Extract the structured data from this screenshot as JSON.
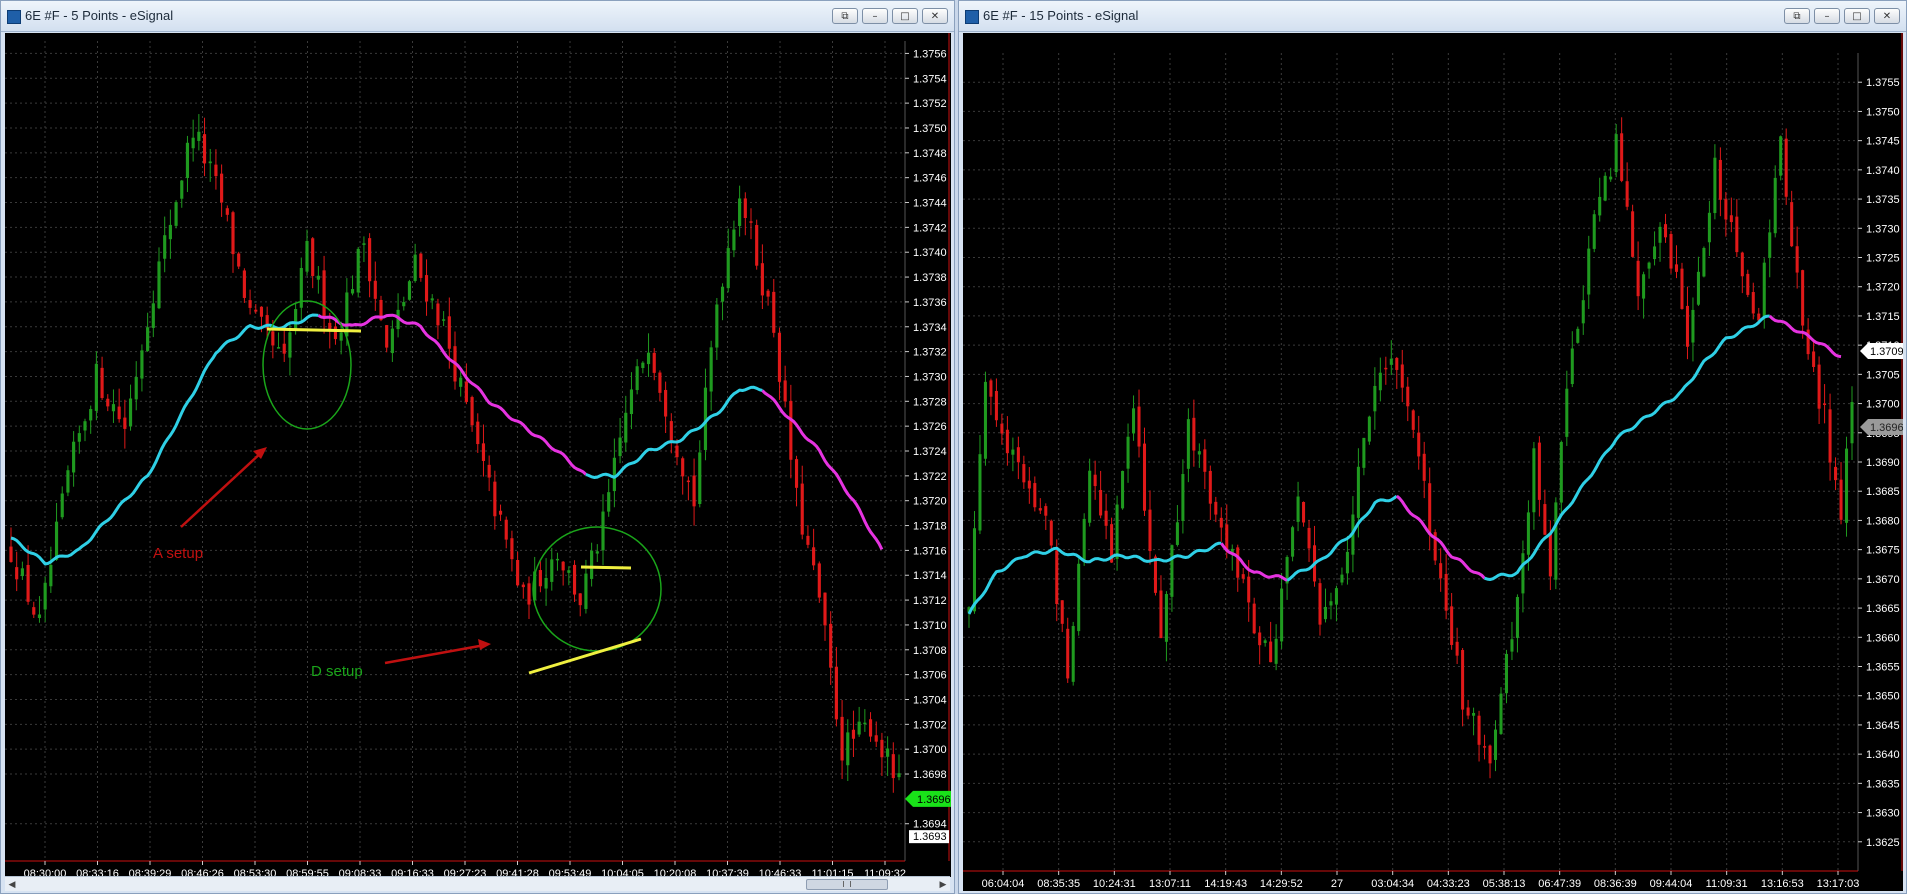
{
  "colors": {
    "bull": "#1f9a1f",
    "bear": "#e01919",
    "ma_up": "#2fd0e6",
    "ma_down": "#e633e0",
    "grid": "#3a3a3a",
    "price_tag": "#19e219",
    "annot_red": "#c01010",
    "annot_green": "#1aa51a",
    "trendline": "#f0f040"
  },
  "left": {
    "title": "6E #F - 5 Points - eSignal",
    "controls": [
      "restore-icon",
      "minimize-icon",
      "maximize-icon",
      "close-icon"
    ],
    "price_tag": "1.3696",
    "price_tag_value": 1.3696,
    "price_tag_low": "1.3693",
    "price_tag_low_value": 1.3693,
    "chart_data": {
      "type": "candlestick",
      "y_ticks": [
        "1.3756",
        "1.3754",
        "1.3752",
        "1.3750",
        "1.3748",
        "1.3746",
        "1.3744",
        "1.3742",
        "1.3740",
        "1.3738",
        "1.3736",
        "1.3734",
        "1.3732",
        "1.3730",
        "1.3728",
        "1.3726",
        "1.3724",
        "1.3722",
        "1.3720",
        "1.3718",
        "1.3716",
        "1.3714",
        "1.3712",
        "1.3710",
        "1.3708",
        "1.3706",
        "1.3704",
        "1.3702",
        "1.3700",
        "1.3698",
        "1.3694"
      ],
      "ylim": [
        1.3691,
        1.3757
      ],
      "x_ticks": [
        "08:30:00",
        "08:33:16",
        "08:39:29",
        "08:46:26",
        "08:53:30",
        "08:59:55",
        "09:08:33",
        "09:16:33",
        "09:27:23",
        "09:41:28",
        "09:53:49",
        "10:04:05",
        "10:20:08",
        "10:37:39",
        "10:46:33",
        "11:01:15",
        "11:09:32"
      ],
      "anchors": [
        [
          0,
          1.3716
        ],
        [
          5,
          1.371
        ],
        [
          10,
          1.3722
        ],
        [
          15,
          1.373
        ],
        [
          20,
          1.3726
        ],
        [
          25,
          1.3737
        ],
        [
          32,
          1.375
        ],
        [
          37,
          1.3744
        ],
        [
          42,
          1.3735
        ],
        [
          48,
          1.3731
        ],
        [
          52,
          1.374
        ],
        [
          57,
          1.3733
        ],
        [
          62,
          1.3741
        ],
        [
          66,
          1.3732
        ],
        [
          71,
          1.3739
        ],
        [
          76,
          1.3734
        ],
        [
          82,
          1.3724
        ],
        [
          86,
          1.3718
        ],
        [
          90,
          1.3712
        ],
        [
          96,
          1.3716
        ],
        [
          100,
          1.3712
        ],
        [
          104,
          1.3718
        ],
        [
          108,
          1.3727
        ],
        [
          112,
          1.3733
        ],
        [
          116,
          1.3726
        ],
        [
          120,
          1.372
        ],
        [
          124,
          1.3736
        ],
        [
          128,
          1.3745
        ],
        [
          134,
          1.3734
        ],
        [
          138,
          1.372
        ],
        [
          142,
          1.3712
        ],
        [
          146,
          1.37
        ],
        [
          151,
          1.3702
        ],
        [
          156,
          1.3697
        ]
      ],
      "ma": [
        [
          0,
          1.3717
        ],
        [
          6,
          1.3715
        ],
        [
          12,
          1.3716
        ],
        [
          18,
          1.3719
        ],
        [
          24,
          1.3722
        ],
        [
          30,
          1.3727
        ],
        [
          36,
          1.3732
        ],
        [
          42,
          1.3734
        ],
        [
          48,
          1.3734
        ],
        [
          54,
          1.3735
        ],
        [
          60,
          1.3734
        ],
        [
          66,
          1.3735
        ],
        [
          72,
          1.3734
        ],
        [
          78,
          1.3731
        ],
        [
          84,
          1.3728
        ],
        [
          90,
          1.3726
        ],
        [
          96,
          1.3724
        ],
        [
          101,
          1.3722
        ],
        [
          106,
          1.3722
        ],
        [
          112,
          1.3724
        ],
        [
          118,
          1.3725
        ],
        [
          124,
          1.3727
        ],
        [
          128,
          1.3729
        ],
        [
          132,
          1.3729
        ],
        [
          136,
          1.3727
        ],
        [
          142,
          1.3724
        ],
        [
          148,
          1.372
        ],
        [
          153,
          1.3716
        ]
      ],
      "ma_split": [
        {
          "from": 0,
          "to": 54,
          "kind": "up"
        },
        {
          "from": 54,
          "to": 101,
          "kind": "down"
        },
        {
          "from": 101,
          "to": 132,
          "kind": "up"
        },
        {
          "from": 132,
          "to": 153,
          "kind": "down"
        }
      ],
      "n_bars": 157
    },
    "annotations": {
      "a_setup": "A setup",
      "d_setup": "D setup"
    }
  },
  "right": {
    "title": "6E #F - 15 Points - eSignal",
    "controls": [
      "restore-icon",
      "minimize-icon",
      "maximize-icon",
      "close-icon"
    ],
    "price_tag": "1.3709",
    "price_tag_value": 1.3709,
    "price_tag2": "1.3696",
    "price_tag2_value": 1.3696,
    "chart_data": {
      "type": "candlestick",
      "y_ticks": [
        "1.3755",
        "1.3750",
        "1.3745",
        "1.3740",
        "1.3735",
        "1.3730",
        "1.3725",
        "1.3720",
        "1.3715",
        "1.3710",
        "1.3705",
        "1.3700",
        "1.3695",
        "1.3690",
        "1.3685",
        "1.3680",
        "1.3675",
        "1.3670",
        "1.3665",
        "1.3660",
        "1.3655",
        "1.3650",
        "1.3645",
        "1.3640",
        "1.3635",
        "1.3630",
        "1.3625"
      ],
      "ylim": [
        1.362,
        1.376
      ],
      "x_ticks": [
        "06:04:04",
        "08:35:35",
        "10:24:31",
        "13:07:11",
        "14:19:43",
        "14:29:52",
        "27",
        "03:04:34",
        "04:33:23",
        "05:38:13",
        "06:47:39",
        "08:36:39",
        "09:44:04",
        "11:09:31",
        "13:16:53",
        "13:17:03"
      ],
      "anchors": [
        [
          0,
          1.3665
        ],
        [
          3,
          1.3705
        ],
        [
          8,
          1.369
        ],
        [
          14,
          1.368
        ],
        [
          18,
          1.3655
        ],
        [
          22,
          1.369
        ],
        [
          26,
          1.3675
        ],
        [
          30,
          1.37
        ],
        [
          35,
          1.366
        ],
        [
          40,
          1.3695
        ],
        [
          46,
          1.368
        ],
        [
          51,
          1.3665
        ],
        [
          55,
          1.3655
        ],
        [
          60,
          1.3685
        ],
        [
          64,
          1.3662
        ],
        [
          69,
          1.3675
        ],
        [
          73,
          1.37
        ],
        [
          78,
          1.3708
        ],
        [
          82,
          1.369
        ],
        [
          86,
          1.3668
        ],
        [
          90,
          1.365
        ],
        [
          95,
          1.364
        ],
        [
          100,
          1.3665
        ],
        [
          103,
          1.369
        ],
        [
          106,
          1.3672
        ],
        [
          110,
          1.371
        ],
        [
          114,
          1.373
        ],
        [
          118,
          1.3745
        ],
        [
          122,
          1.372
        ],
        [
          127,
          1.373
        ],
        [
          131,
          1.3712
        ],
        [
          136,
          1.374
        ],
        [
          140,
          1.3725
        ],
        [
          144,
          1.3715
        ],
        [
          148,
          1.3745
        ],
        [
          152,
          1.3712
        ],
        [
          156,
          1.3698
        ],
        [
          159,
          1.368
        ],
        [
          161,
          1.37
        ]
      ],
      "ma": [
        [
          0,
          1.3664
        ],
        [
          5,
          1.3671
        ],
        [
          10,
          1.3674
        ],
        [
          16,
          1.3675
        ],
        [
          22,
          1.3673
        ],
        [
          28,
          1.3674
        ],
        [
          34,
          1.3673
        ],
        [
          40,
          1.3674
        ],
        [
          46,
          1.3676
        ],
        [
          52,
          1.3671
        ],
        [
          58,
          1.367
        ],
        [
          64,
          1.3673
        ],
        [
          70,
          1.3678
        ],
        [
          74,
          1.3683
        ],
        [
          78,
          1.3684
        ],
        [
          82,
          1.368
        ],
        [
          88,
          1.3674
        ],
        [
          94,
          1.367
        ],
        [
          100,
          1.3671
        ],
        [
          106,
          1.3678
        ],
        [
          112,
          1.3686
        ],
        [
          118,
          1.3694
        ],
        [
          124,
          1.3698
        ],
        [
          130,
          1.3702
        ],
        [
          134,
          1.3707
        ],
        [
          138,
          1.3711
        ],
        [
          142,
          1.3713
        ],
        [
          146,
          1.3715
        ],
        [
          150,
          1.3713
        ],
        [
          154,
          1.3711
        ],
        [
          159,
          1.3708
        ]
      ],
      "ma_split": [
        {
          "from": 0,
          "to": 46,
          "kind": "up"
        },
        {
          "from": 46,
          "to": 58,
          "kind": "down"
        },
        {
          "from": 58,
          "to": 78,
          "kind": "up"
        },
        {
          "from": 78,
          "to": 94,
          "kind": "down"
        },
        {
          "from": 94,
          "to": 146,
          "kind": "up"
        },
        {
          "from": 146,
          "to": 159,
          "kind": "down"
        }
      ],
      "n_bars": 162
    }
  }
}
